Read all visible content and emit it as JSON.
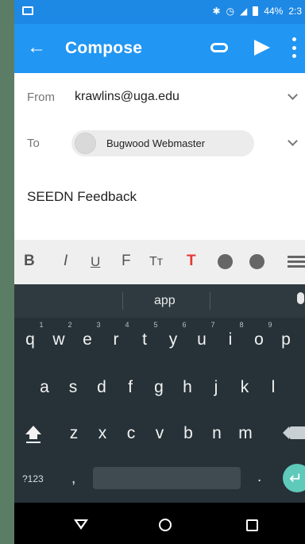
{
  "status_bar": {
    "battery": "44%",
    "time": "2:3"
  },
  "app_bar": {
    "title": "Compose"
  },
  "compose": {
    "from_label": "From",
    "from_value": "krawlins@uga.edu",
    "to_label": "To",
    "to_recipient": "Bugwood Webmaster",
    "subject": "SEEDN Feedback"
  },
  "format_toolbar": {
    "bold": "B",
    "italic": "I",
    "underline": "U",
    "font": "F",
    "text_size": "Tт",
    "text_color": "T"
  },
  "keyboard": {
    "suggestion": "app",
    "numbers": [
      "1",
      "2",
      "3",
      "4",
      "5",
      "6",
      "7",
      "8",
      "9"
    ],
    "row1": [
      "q",
      "w",
      "e",
      "r",
      "t",
      "y",
      "u",
      "i",
      "o",
      "p"
    ],
    "row2": [
      "a",
      "s",
      "d",
      "f",
      "g",
      "h",
      "j",
      "k",
      "l"
    ],
    "row3": [
      "z",
      "x",
      "c",
      "v",
      "b",
      "n",
      "m"
    ],
    "symbols_key": "?123",
    "comma_key": ",",
    "period_key": "."
  },
  "colors": {
    "app_bar": "#2196f3",
    "status_bar": "#1e88e5",
    "keyboard_bg": "#263238",
    "enter_key": "#5fc9ba",
    "text_color_icon": "#e53935"
  },
  "icons": {
    "back": "arrow-left-icon",
    "attach": "paperclip-icon",
    "send": "send-icon",
    "more": "more-vert-icon",
    "palette": "palette-icon",
    "emoji": "emoji-icon",
    "list": "list-icon"
  }
}
